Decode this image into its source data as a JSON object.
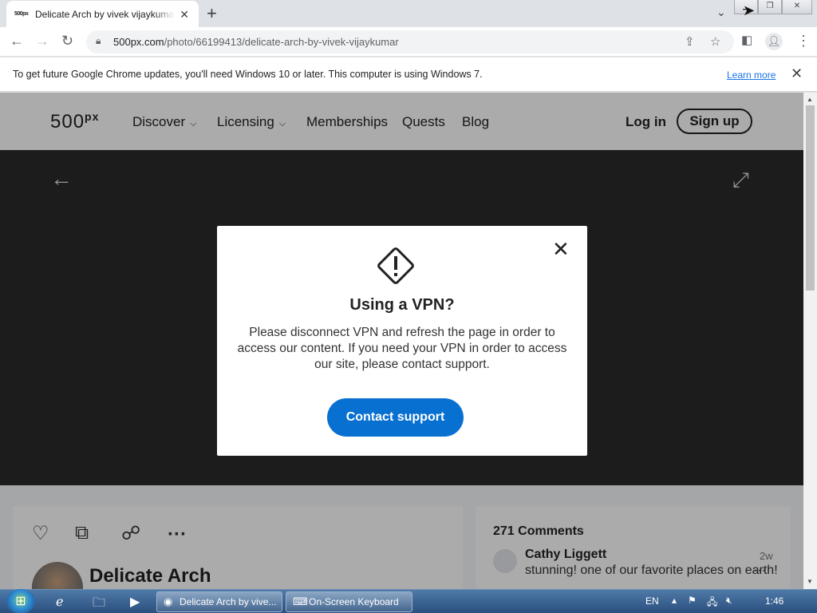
{
  "browser": {
    "tab_title": "Delicate Arch by vivek vijaykumar",
    "tab_favicon": "500px",
    "url_host": "500px.com",
    "url_path": "/photo/66199413/delicate-arch-by-vivek-vijaykumar",
    "infobar_text": "To get future Google Chrome updates, you'll need Windows 10 or later. This computer is using Windows 7.",
    "infobar_link": "Learn more"
  },
  "site": {
    "logo": "500",
    "logo_sup": "px",
    "nav": [
      "Discover",
      "Licensing",
      "Memberships",
      "Quests",
      "Blog"
    ],
    "login": "Log in",
    "signup": "Sign up"
  },
  "photo": {
    "title": "Delicate Arch"
  },
  "comments": {
    "count_label": "271 Comments",
    "first": {
      "name": "Cathy Liggett",
      "age": "2w",
      "text": "stunning! one of our favorite places on earth!"
    }
  },
  "modal": {
    "title": "Using a VPN?",
    "body": "Please disconnect VPN and refresh the page in order to access our content. If you need your VPN in order to access our site, please contact support.",
    "button": "Contact support"
  },
  "taskbar": {
    "tasks": [
      "Delicate Arch by vive...",
      "On-Screen Keyboard"
    ],
    "lang": "EN",
    "clock": "1:46"
  },
  "colors": {
    "accent": "#0870d1",
    "link": "#1a73e8"
  }
}
